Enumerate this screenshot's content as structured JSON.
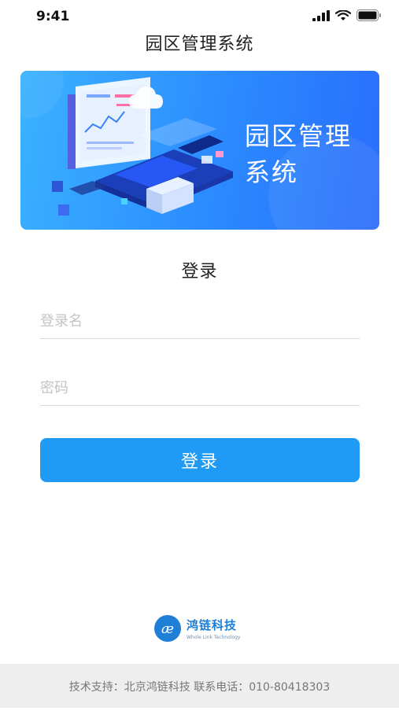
{
  "status_bar": {
    "time": "9:41"
  },
  "header": {
    "title": "园区管理系统"
  },
  "banner": {
    "title": "园区管理系统"
  },
  "login": {
    "heading": "登录",
    "username_placeholder": "登录名",
    "password_placeholder": "密码",
    "submit_label": "登录"
  },
  "brand": {
    "name": "鸿链科技",
    "english": "Whole Link Technology"
  },
  "footer": {
    "text": "技术支持：北京鸿链科技 联系电话：010-80418303"
  },
  "colors": {
    "primary": "#1f9bf5",
    "banner_start": "#3bb2ff",
    "banner_end": "#2a6dfa"
  }
}
